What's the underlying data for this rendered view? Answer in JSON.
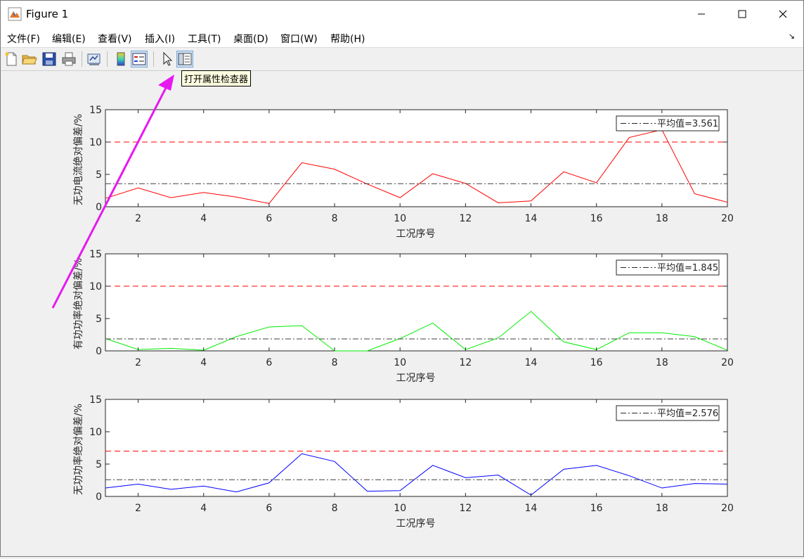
{
  "window": {
    "title": "Figure 1",
    "icon": "matlab-figure-icon"
  },
  "window_controls": {
    "minimize_icon": "minimize-icon",
    "maximize_icon": "maximize-icon",
    "close_icon": "close-icon"
  },
  "menu": {
    "items": [
      "文件(F)",
      "编辑(E)",
      "查看(V)",
      "插入(I)",
      "工具(T)",
      "桌面(D)",
      "窗口(W)",
      "帮助(H)"
    ],
    "overflow_icon": "dock-arrow-icon"
  },
  "toolbar": {
    "buttons": [
      {
        "name": "new-figure",
        "icon": "new-figure-icon"
      },
      {
        "name": "open-file",
        "icon": "open-folder-icon"
      },
      {
        "name": "save-figure",
        "icon": "save-icon"
      },
      {
        "name": "print-figure",
        "icon": "print-icon"
      },
      {
        "name": "link-plot",
        "icon": "link-plot-icon"
      },
      {
        "name": "insert-colorbar",
        "icon": "colorbar-icon"
      },
      {
        "name": "insert-legend",
        "icon": "legend-icon"
      },
      {
        "name": "edit-plot",
        "icon": "pointer-icon"
      },
      {
        "name": "property-inspector",
        "icon": "property-inspector-icon"
      }
    ],
    "tooltip": "打开属性检查器"
  },
  "annotation": {
    "arrow_color": "#e619f0"
  },
  "chart_data": [
    {
      "type": "line",
      "xlabel": "工况序号",
      "ylabel": "无功电流绝对偏差/%",
      "xlim": [
        1,
        20
      ],
      "ylim": [
        0,
        15
      ],
      "xticks": [
        2,
        4,
        6,
        8,
        10,
        12,
        14,
        16,
        18,
        20
      ],
      "yticks": [
        0,
        5,
        10,
        15
      ],
      "grid": false,
      "legend": {
        "position": "top-right",
        "label": "平均值=3.561"
      },
      "x": [
        1,
        2,
        3,
        4,
        5,
        6,
        7,
        8,
        9,
        10,
        11,
        12,
        13,
        14,
        15,
        16,
        17,
        18,
        19,
        20
      ],
      "series": [
        {
          "values": [
            1.3,
            2.9,
            1.4,
            2.2,
            1.5,
            0.5,
            6.8,
            5.8,
            3.5,
            1.4,
            5.1,
            3.6,
            0.6,
            0.9,
            5.4,
            3.7,
            10.7,
            11.9,
            2.0,
            0.7
          ],
          "color": "#ff0000",
          "style": "solid"
        },
        {
          "values": [
            3.561,
            3.561
          ],
          "x": [
            1,
            20
          ],
          "color": "#404040",
          "style": "dashdot"
        },
        {
          "values": [
            10,
            10
          ],
          "x": [
            1,
            20
          ],
          "color": "#ff0000",
          "style": "dashed"
        }
      ]
    },
    {
      "type": "line",
      "xlabel": "工况序号",
      "ylabel": "有功功率绝对偏差/%",
      "xlim": [
        1,
        20
      ],
      "ylim": [
        0,
        15
      ],
      "xticks": [
        2,
        4,
        6,
        8,
        10,
        12,
        14,
        16,
        18,
        20
      ],
      "yticks": [
        0,
        5,
        10,
        15
      ],
      "grid": false,
      "legend": {
        "position": "top-right",
        "label": "平均值=1.845"
      },
      "x": [
        1,
        2,
        3,
        4,
        5,
        6,
        7,
        8,
        9,
        10,
        11,
        12,
        13,
        14,
        15,
        16,
        17,
        18,
        19,
        20
      ],
      "series": [
        {
          "values": [
            1.9,
            0.2,
            0.4,
            0.1,
            2.2,
            3.7,
            3.9,
            0.0,
            0.0,
            1.9,
            4.3,
            0.2,
            2.0,
            6.1,
            1.4,
            0.2,
            2.8,
            2.8,
            2.2,
            0.1
          ],
          "color": "#00ee00",
          "style": "solid"
        },
        {
          "values": [
            1.845,
            1.845
          ],
          "x": [
            1,
            20
          ],
          "color": "#404040",
          "style": "dashdot"
        },
        {
          "values": [
            10,
            10
          ],
          "x": [
            1,
            20
          ],
          "color": "#ff0000",
          "style": "dashed"
        }
      ]
    },
    {
      "type": "line",
      "xlabel": "工况序号",
      "ylabel": "无功功率绝对偏差/%",
      "xlim": [
        1,
        20
      ],
      "ylim": [
        0,
        15
      ],
      "xticks": [
        2,
        4,
        6,
        8,
        10,
        12,
        14,
        16,
        18,
        20
      ],
      "yticks": [
        0,
        5,
        10,
        15
      ],
      "grid": false,
      "legend": {
        "position": "top-right",
        "label": "平均值=2.576"
      },
      "x": [
        1,
        2,
        3,
        4,
        5,
        6,
        7,
        8,
        9,
        10,
        11,
        12,
        13,
        14,
        15,
        16,
        17,
        18,
        19,
        20
      ],
      "series": [
        {
          "values": [
            1.3,
            1.9,
            1.1,
            1.6,
            0.7,
            2.1,
            6.6,
            5.4,
            0.8,
            0.9,
            4.8,
            2.9,
            3.3,
            0.2,
            4.2,
            4.8,
            3.2,
            1.3,
            2.0,
            1.9
          ],
          "color": "#0000ff",
          "style": "solid"
        },
        {
          "values": [
            2.576,
            2.576
          ],
          "x": [
            1,
            20
          ],
          "color": "#404040",
          "style": "dashdot"
        },
        {
          "values": [
            7,
            7
          ],
          "x": [
            1,
            20
          ],
          "color": "#ff0000",
          "style": "dashed"
        }
      ]
    }
  ]
}
